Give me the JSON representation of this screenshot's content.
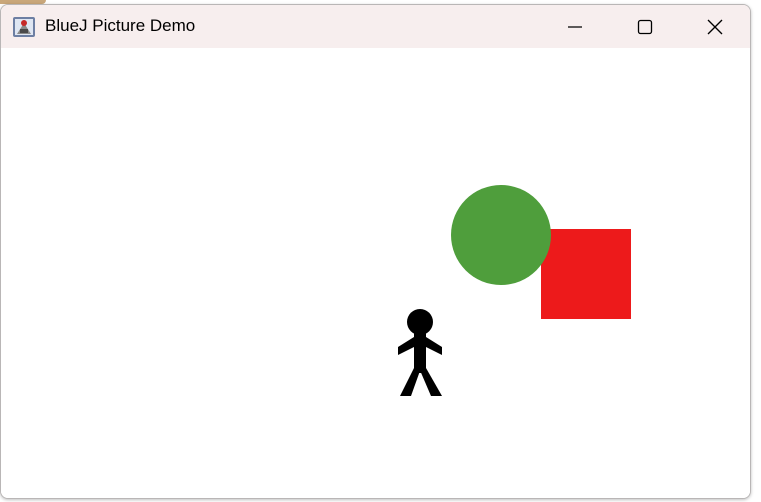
{
  "window": {
    "title": "BlueJ Picture Demo",
    "app_icon": "bluej-icon",
    "controls": {
      "minimize_icon": "minimize-icon",
      "maximize_icon": "maximize-icon",
      "close_icon": "close-icon"
    }
  },
  "canvas": {
    "background": "#ffffff",
    "shapes": [
      {
        "kind": "circle",
        "name": "green-circle",
        "color": "#4f9e3c"
      },
      {
        "kind": "square",
        "name": "red-square",
        "color": "#ed1a1b"
      },
      {
        "kind": "person",
        "name": "stick-person",
        "color": "#000000"
      }
    ]
  }
}
